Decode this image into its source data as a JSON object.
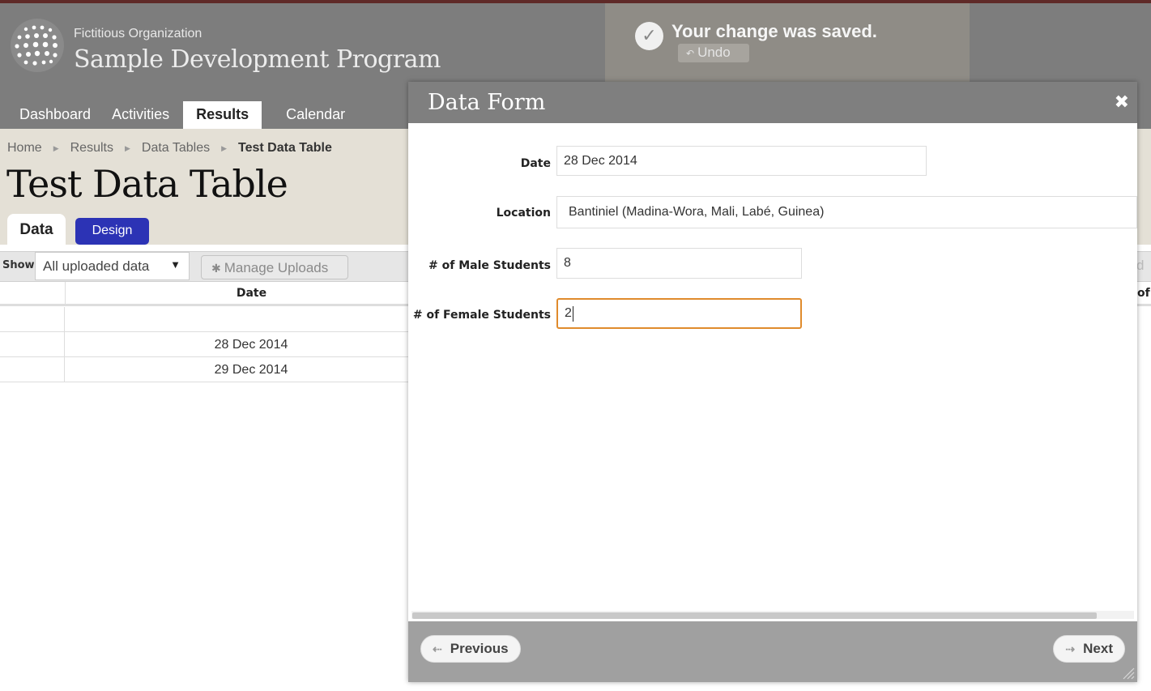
{
  "header": {
    "org_name": "Fictitious Organization",
    "program_name": "Sample Development Program"
  },
  "nav": {
    "items": [
      {
        "label": "Dashboard"
      },
      {
        "label": "Activities"
      },
      {
        "label": "Results",
        "active": true
      },
      {
        "label": "Calendar"
      }
    ]
  },
  "breadcrumb": {
    "items": [
      "Home",
      "Results",
      "Data Tables"
    ],
    "current": "Test Data Table"
  },
  "page": {
    "title": "Test Data Table",
    "tabs": [
      {
        "label": "Data",
        "active": true
      },
      {
        "label": "Design"
      }
    ]
  },
  "toolbar": {
    "show_label": "Show",
    "show_value": "All uploaded data",
    "manage_label": "Manage Uploads",
    "right_fragment": "d"
  },
  "table": {
    "columns": [
      "Date"
    ],
    "right_header_fragment": "of",
    "rows": [
      "",
      "28 Dec 2014",
      "29 Dec 2014"
    ]
  },
  "toast": {
    "message": "Your change was saved.",
    "undo_label": "Undo"
  },
  "modal": {
    "title": "Data Form",
    "close_icon": "close-icon",
    "fields": [
      {
        "label": "Date",
        "value": "28 Dec 2014"
      },
      {
        "label": "Location",
        "value": "Bantiniel (Madina-Wora, Mali, Labé, Guinea)"
      },
      {
        "label": "# of Male Students",
        "value": "8"
      },
      {
        "label": "# of Female Students",
        "value": "2",
        "focused": true
      }
    ],
    "previous_label": "Previous",
    "next_label": "Next"
  },
  "colors": {
    "header_bg": "#7d7d7d",
    "accent_design_tab": "#2c33b5",
    "focus_border": "#e08b2c",
    "topline": "#5f2a28"
  }
}
